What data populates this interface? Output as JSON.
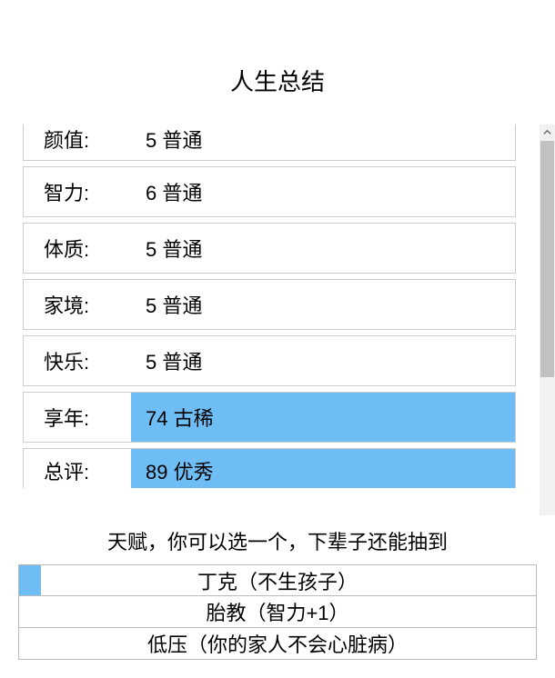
{
  "title": "人生总结",
  "stats": [
    {
      "label": "颜值:",
      "value": "5 普通",
      "highlight": false
    },
    {
      "label": "智力:",
      "value": "6 普通",
      "highlight": false
    },
    {
      "label": "体质:",
      "value": "5 普通",
      "highlight": false
    },
    {
      "label": "家境:",
      "value": "5 普通",
      "highlight": false
    },
    {
      "label": "快乐:",
      "value": "5 普通",
      "highlight": false
    },
    {
      "label": "享年:",
      "value": "74 古稀",
      "highlight": true
    },
    {
      "label": "总评:",
      "value": "89 优秀",
      "highlight": true
    }
  ],
  "talent_heading": "天赋，你可以选一个，下辈子还能抽到",
  "talents": [
    {
      "label": "丁克（不生孩子）",
      "selected": true
    },
    {
      "label": "胎教（智力+1）",
      "selected": false
    },
    {
      "label": "低压（你的家人不会心脏病）",
      "selected": false
    }
  ]
}
